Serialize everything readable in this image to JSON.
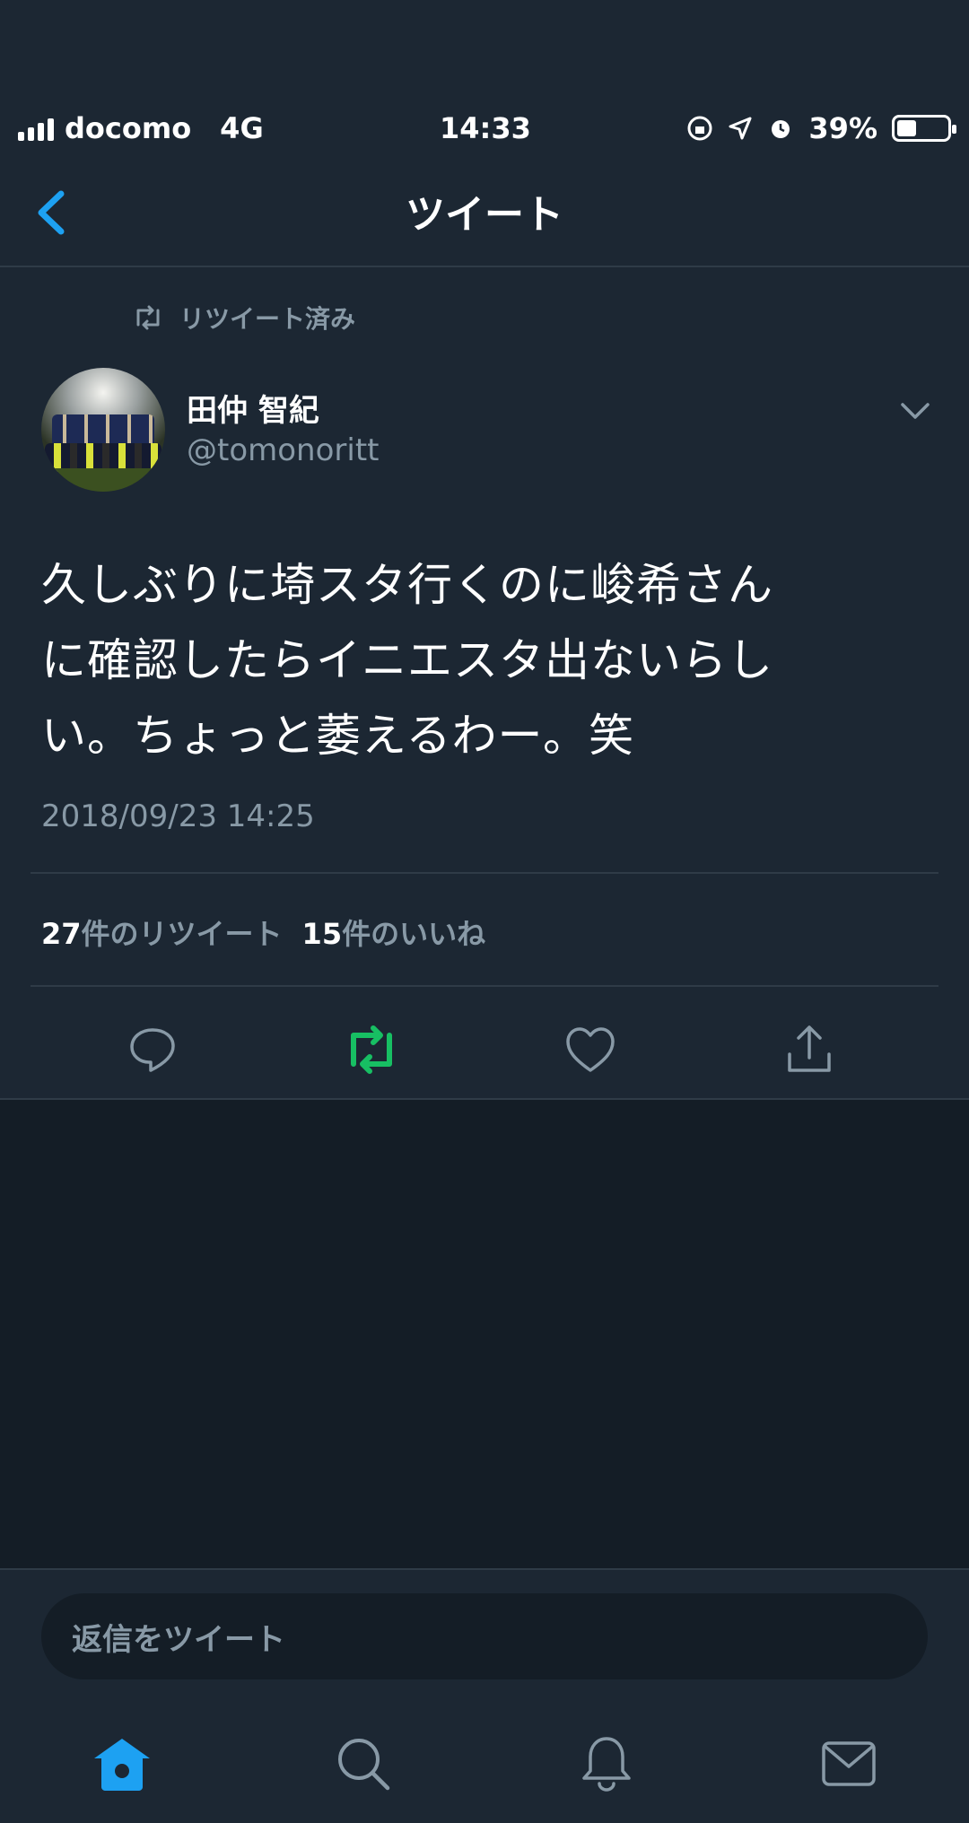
{
  "status_bar": {
    "carrier": "docomo",
    "network": "4G",
    "time": "14:33",
    "battery": "39%",
    "battery_level": 0.39
  },
  "nav": {
    "title": "ツイート"
  },
  "tweet": {
    "retweet_label": "リツイート済み",
    "author_name": "田仲 智紀",
    "author_handle": "@tomonoritt",
    "text_lines": [
      "久しぶりに埼スタ行くのに峻希さん",
      "に確認したらイニエスタ出ないらし",
      "い。ちょっと萎えるわー。笑"
    ],
    "timestamp": "2018/09/23 14:25",
    "retweet_count": "27",
    "retweet_suffix": "件のリツイート",
    "like_count": "15",
    "like_suffix": "件のいいね"
  },
  "reply": {
    "placeholder": "返信をツイート"
  },
  "colors": {
    "accent": "#1da1f2",
    "retweet_active": "#17bf63",
    "muted": "#8899a6",
    "bg": "#141d26",
    "panel": "#1c2733"
  },
  "icons": [
    "chevron-left-icon",
    "retweet-icon",
    "chevron-down-icon",
    "reply-icon",
    "like-icon",
    "share-icon",
    "home-icon",
    "search-icon",
    "notifications-icon",
    "messages-icon"
  ]
}
